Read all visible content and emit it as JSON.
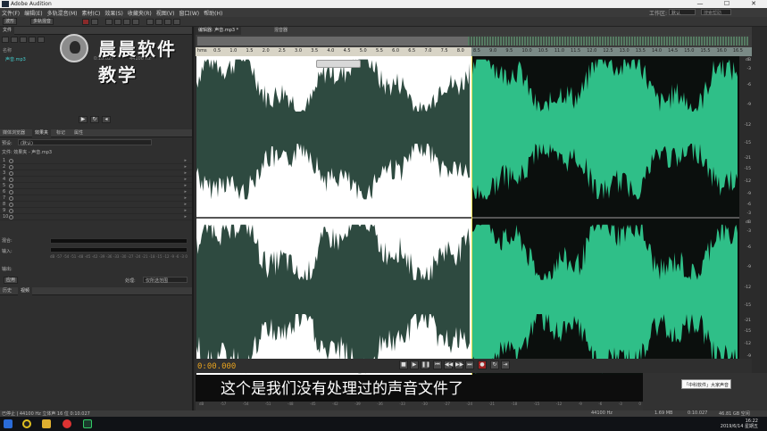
{
  "window": {
    "title": "Adobe Audition",
    "controls": [
      "—",
      "☐",
      "✕"
    ]
  },
  "menu": [
    "文件(F)",
    "编辑(E)",
    "多轨混音(M)",
    "素材(C)",
    "效果(S)",
    "收藏夹(R)",
    "视图(V)",
    "窗口(W)",
    "帮助(H)"
  ],
  "workspace": {
    "label": "工作区:",
    "value": "默认",
    "help_placeholder": "搜索帮助"
  },
  "toolbar": {
    "waveform_label": "波形",
    "multitrack_label": "多轨混音"
  },
  "files_panel": {
    "title": "文件",
    "header_name": "名称",
    "file_name": "声音.mp3",
    "file_duration": "0:10.027",
    "file_rate": "44100 Hz"
  },
  "effects_panel": {
    "tabs": [
      "媒体浏览器",
      "效果夹",
      "标记",
      "属性"
    ],
    "preset_label": "预设:",
    "preset_value": "(默认)",
    "file_label": "文件: 效果夹 - 声音.mp3",
    "slots": [
      "1",
      "2",
      "3",
      "4",
      "5",
      "6",
      "7",
      "8",
      "9",
      "10"
    ],
    "mix_label": "混合:",
    "input_label": "输入:",
    "output_label": "输出:",
    "db_ticks": [
      "dB",
      "-57",
      "-54",
      "-51",
      "-48",
      "-45",
      "-42",
      "-39",
      "-36",
      "-33",
      "-30",
      "-27",
      "-24",
      "-21",
      "-18",
      "-15",
      "-12",
      "-9",
      "-6",
      "-3",
      "0"
    ],
    "apply_label": "应用",
    "process_label": "处理:",
    "process_value": "仅所选范围"
  },
  "history_panel": {
    "tabs": [
      "历史",
      "视频"
    ]
  },
  "editor": {
    "tabs": [
      "编辑器: 声音.mp3 *",
      "混音器"
    ],
    "ruler_ticks": [
      "hms",
      "0.5",
      "1.0",
      "1.5",
      "2.0",
      "2.5",
      "3.0",
      "3.5",
      "4.0",
      "4.5",
      "5.0",
      "5.5",
      "6.0",
      "6.5",
      "7.0",
      "7.5",
      "8.0",
      "8.5",
      "9.0",
      "9.5",
      "10.0",
      "10.5",
      "11.0",
      "11.5",
      "12.0",
      "12.5",
      "13.0",
      "13.5",
      "14.0",
      "14.5",
      "15.0",
      "15.5",
      "16.0",
      "16.5"
    ],
    "db_ticks_top": [
      "dB",
      "-3",
      "-6",
      "-9",
      "-12",
      "-15",
      "-21",
      "-15",
      "-12",
      "-9",
      "-6",
      "-3"
    ],
    "db_ticks_bottom": [
      "dB",
      "-3",
      "-6",
      "-9",
      "-12",
      "-15",
      "-21",
      "-15",
      "-12",
      "-9",
      "-6",
      "-3"
    ],
    "colors": {
      "selected_wave": "#2e4a40",
      "unselected_wave": "#2fbf88",
      "selection_bg": "#ffffff"
    }
  },
  "transport": {
    "timecode": "0:00.000",
    "buttons": [
      "stop-icon",
      "play-icon",
      "pause-icon",
      "go-start-icon",
      "rewind-icon",
      "fast-forward-icon",
      "go-end-icon",
      "record-icon",
      "loop-icon",
      "skip-icon"
    ]
  },
  "subtitle": "这个是我们没有处理过的声音文件了",
  "level_ticks": [
    "dB",
    "-57",
    "-54",
    "-51",
    "-48",
    "-45",
    "-42",
    "-39",
    "-36",
    "-33",
    "-30",
    "-27",
    "-24",
    "-21",
    "-18",
    "-15",
    "-12",
    "-9",
    "-6",
    "-3",
    "0"
  ],
  "tooltip": "「中科软件」大家声音",
  "status": {
    "left": "已停止 | 44100 Hz 立体声 16 位 0:10.027",
    "right_rate": "44100 Hz",
    "right_size": "1.69 MB",
    "right_duration": "0:10.027",
    "right_free": "46.81 GB 空闲"
  },
  "watermark": "晨晨软件教学",
  "taskbar": {
    "time": "16:22",
    "date": "2019/6/14 星期五"
  }
}
